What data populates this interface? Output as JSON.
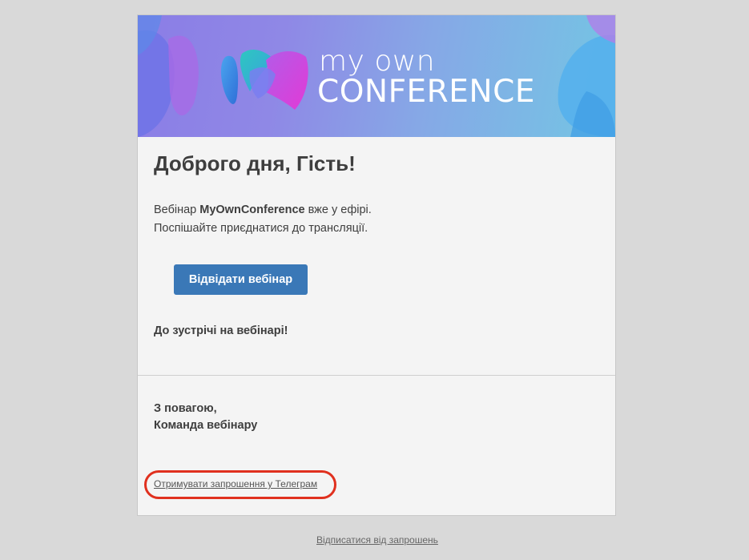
{
  "banner": {
    "brand_line1": "my own",
    "brand_line2": "CONFERENCE",
    "colors": {
      "gradient_start": "#8b7de6",
      "gradient_end": "#73c6e4",
      "logo_blue": "#3d8fe0",
      "logo_teal": "#2cb9b0",
      "logo_magenta": "#d93ad8"
    }
  },
  "email": {
    "greeting": "Доброго дня, Гість!",
    "intro_prefix": "Вебінар ",
    "intro_name": "MyOwnConference",
    "intro_suffix": " вже у ефірі.",
    "intro_line2": "Поспішайте приєднатися до трансляції.",
    "cta_label": "Відвідати вебінар",
    "see_you": "До зустрічі на вебінарі!",
    "signoff_line1": "З повагою,",
    "signoff_line2": "Команда вебінару",
    "telegram_link": "Отримувати запрошення у Телеграм"
  },
  "footer": {
    "unsubscribe": "Відписатися від запрошень"
  },
  "annotation": {
    "highlight_color": "#e0301e"
  },
  "colors": {
    "page_background": "#d9d9d9",
    "card_background": "#f4f4f4",
    "button_background": "#3a78b7"
  }
}
